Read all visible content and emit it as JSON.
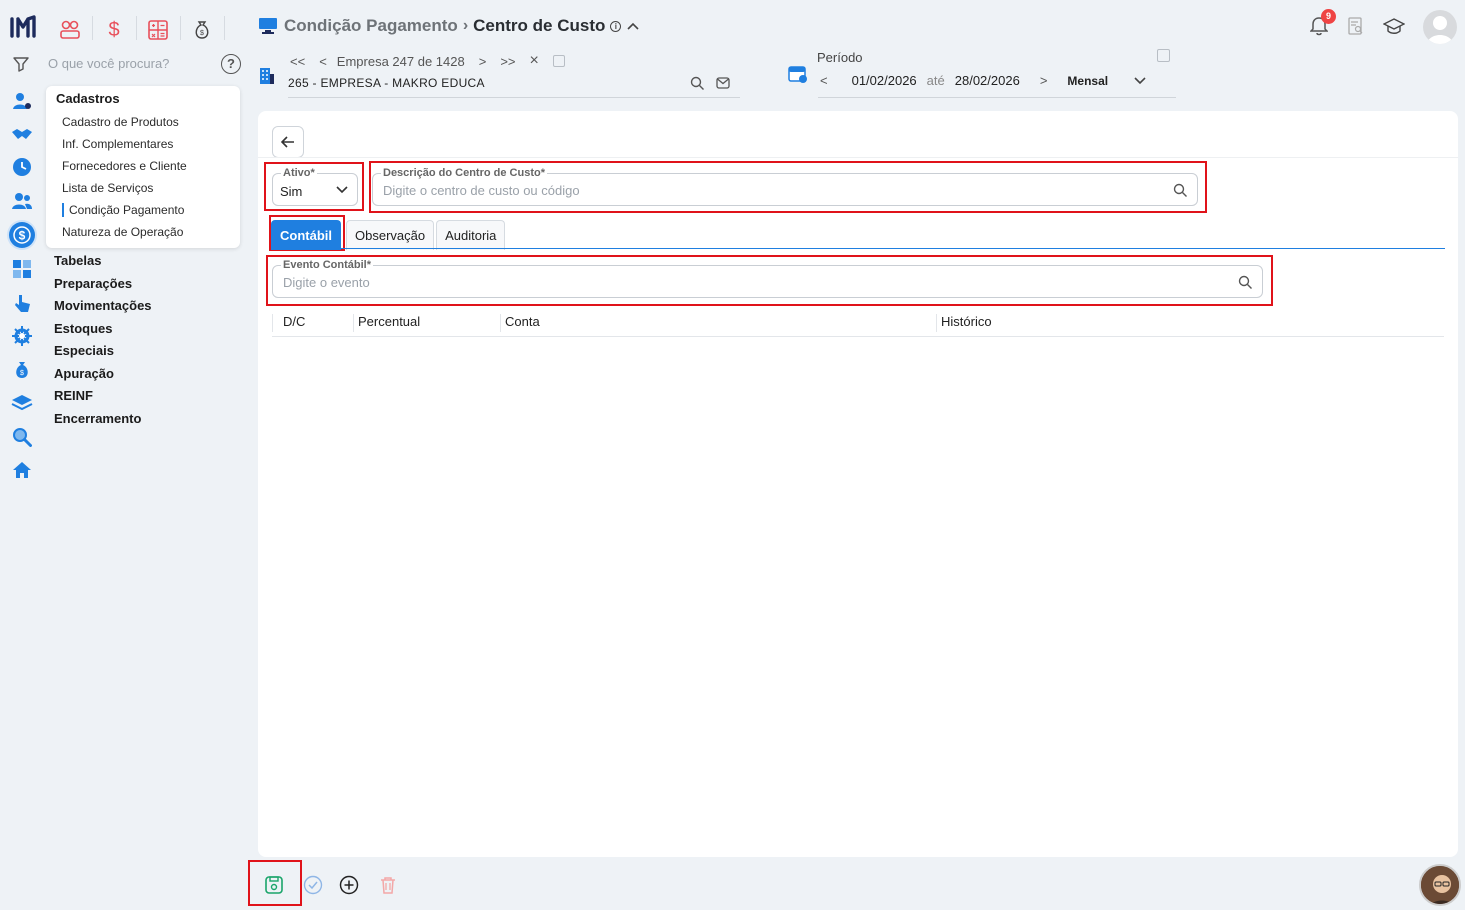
{
  "header": {
    "breadcrumb_parent": "Condição Pagamento",
    "breadcrumb_current": "Centro de Custo",
    "info_glyph": "i",
    "notification_count": "9"
  },
  "sidebar": {
    "search_placeholder": "O que você procura?",
    "help_glyph": "?",
    "panel_title": "Cadastros",
    "panel_items": [
      {
        "label": "Cadastro de Produtos"
      },
      {
        "label": "Inf. Complementares"
      },
      {
        "label": "Fornecedores e Cliente"
      },
      {
        "label": "Lista de Serviços"
      },
      {
        "label": "Condição Pagamento"
      },
      {
        "label": "Natureza de Operação"
      }
    ],
    "menu": [
      "Tabelas",
      "Preparações",
      "Movimentações",
      "Estoques",
      "Especiais",
      "Apuração",
      "REINF",
      "Encerramento"
    ]
  },
  "empresa": {
    "first": "<<",
    "prev": "<",
    "position": "Empresa 247 de 1428",
    "next": ">",
    "last": ">>",
    "close": "×",
    "name": "265 - EMPRESA - MAKRO EDUCA"
  },
  "periodo": {
    "label": "Período",
    "prev": "<",
    "start": "01/02/2026",
    "ate": "até",
    "end": "28/02/2026",
    "next": ">",
    "mode": "Mensal"
  },
  "form": {
    "ativo_label": "Ativo*",
    "ativo_value": "Sim",
    "descricao_label": "Descrição do Centro de Custo*",
    "descricao_placeholder": "Digite o centro de custo ou código",
    "tabs": [
      "Contábil",
      "Observação",
      "Auditoria"
    ],
    "active_tab": "Contábil",
    "evento_label": "Evento Contábil*",
    "evento_placeholder": "Digite o evento",
    "columns": [
      "D/C",
      "Percentual",
      "Conta",
      "Histórico"
    ]
  },
  "colors": {
    "accent": "#1f7fe0",
    "highlight": "#e0131a",
    "save_green": "#1aa56a",
    "delete_red": "#f3a7a7"
  }
}
